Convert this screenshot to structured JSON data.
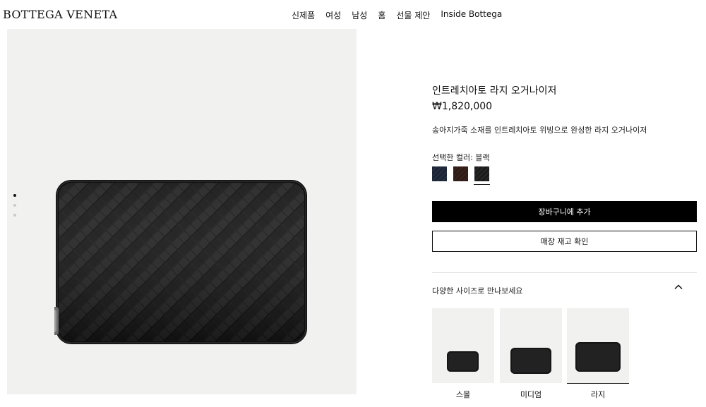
{
  "header": {
    "logo": "BOTTEGA VENETA",
    "nav": [
      "신제품",
      "여성",
      "남성",
      "홈",
      "선물 제안",
      "Inside Bottega"
    ]
  },
  "gallery": {
    "dot_count": 3,
    "active_dot": 1
  },
  "product": {
    "title": "인트레치아토 라지 오거나이저",
    "price": "₩1,820,000",
    "description": "송아지가죽 소재를 인트레치아토 위빙으로 완성한 라지 오거나이저",
    "color_label": "선택한 컬러: 블랙",
    "swatches": [
      {
        "name": "navy-swatch",
        "color": "#1c2536"
      },
      {
        "name": "brown-swatch",
        "color": "#2f1c17"
      },
      {
        "name": "black-swatch",
        "color": "#1b1b1b",
        "selected": true
      }
    ],
    "add_to_cart": "장바구니에 추가",
    "check_store": "매장 재고 확인"
  },
  "sizes": {
    "heading": "다양한 사이즈로 만나보세요",
    "chevron_icon": "chevron-up-icon",
    "items": [
      {
        "label": "스몰"
      },
      {
        "label": "미디엄"
      },
      {
        "label": "라지",
        "selected": true
      }
    ]
  },
  "colors": {
    "accent": "#000000",
    "panel_bg": "#f1f2f0"
  }
}
